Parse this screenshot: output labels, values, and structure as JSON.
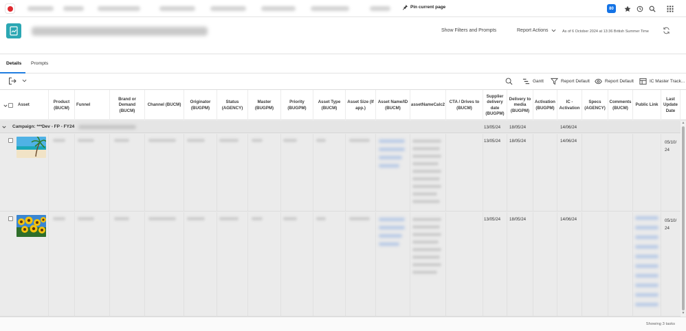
{
  "topbar": {
    "pin_label": "Pin current page",
    "badge": "80",
    "icons": [
      "star-icon",
      "history-icon",
      "search-icon",
      "apps-grid-icon"
    ]
  },
  "header": {
    "show_filters": "Show Filters and Prompts",
    "report_actions": "Report Actions",
    "as_of": "As of 6 October 2024 at 13:36 British Summer Time"
  },
  "tabs": [
    {
      "label": "Details",
      "active": true
    },
    {
      "label": "Prompts",
      "active": false
    }
  ],
  "toolbar": {
    "gantt": "Gantt",
    "filter": "Report Default",
    "view": "Report Default",
    "grouping": "IC Master Track..."
  },
  "columns": [
    "Asset",
    "Product (BUCM)",
    "Funnel",
    "Brand or Demand (BUCM)",
    "Channel (BUCM)",
    "Originator (BUGPM)",
    "Status (AGENCY)",
    "Master (BUGPM)",
    "Priority (BUGPM)",
    "Asset Type (BUCM)",
    "Asset Size (If app.)",
    "Asset Name/ID (BUCM)",
    "assetNameCalc2",
    "CTA / Drives to (BUCM)",
    "Supplier delivery date (BUGPM)",
    "Delivery to media (BUGPM)",
    "Activation (BUGPM)",
    "IC - Activation",
    "Specs (AGENCY)",
    "Comments (BUCM)",
    "Public Link",
    "Last Update Date"
  ],
  "group": {
    "label": "Campaign: ***Dev - FP - FY24",
    "supplier_delivery": "13/05/24",
    "delivery_to_media": "18/05/24",
    "ic_activation": "14/06/24"
  },
  "rows": [
    {
      "thumbnail": "beach-palm-tree-image",
      "supplier_delivery": "13/05/24",
      "delivery_to_media": "18/05/24",
      "ic_activation": "14/06/24",
      "last_update": "05/10/24"
    },
    {
      "thumbnail": "sunflowers-image",
      "supplier_delivery": "13/05/24",
      "delivery_to_media": "18/05/24",
      "ic_activation": "14/06/24",
      "last_update": "05/10/24"
    }
  ],
  "footer": {
    "count": "Showing 3 tasks"
  },
  "colors": {
    "accent": "#1473e6",
    "project_icon": "#2ba7b3",
    "logo": "#e0292f"
  }
}
